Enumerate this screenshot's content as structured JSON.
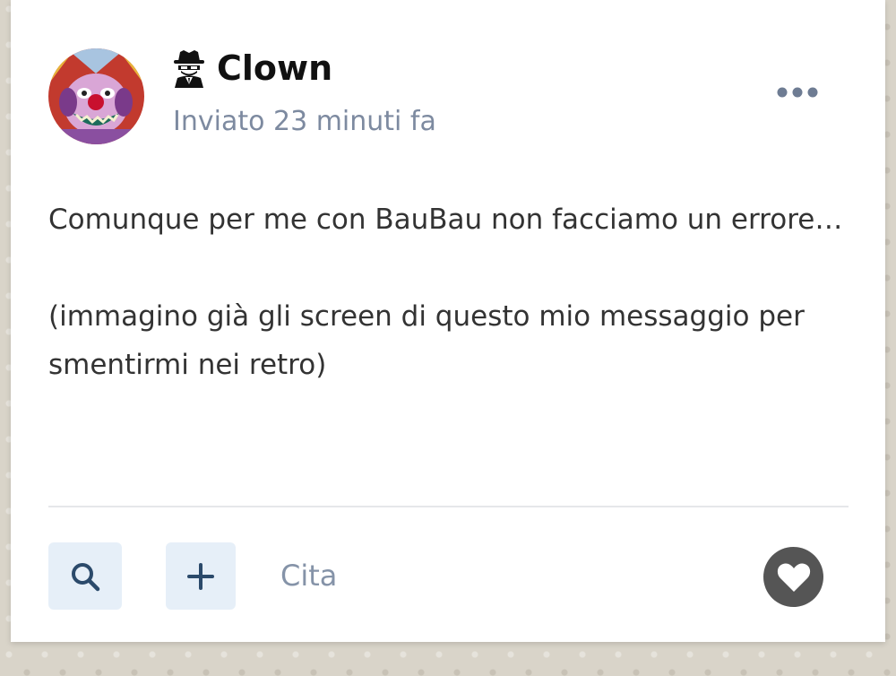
{
  "post": {
    "author": {
      "name": "Clown",
      "badge_icon": "spy-icon",
      "avatar_icon": "clown-avatar"
    },
    "timestamp": "Inviato 23 minuti fa",
    "menu_icon": "more-horizontal-icon",
    "body": [
      "Comunque per me con BauBau non facciamo un errore…",
      "(immagino già gli screen di questo mio messaggio per smentirmi nei retro)"
    ]
  },
  "actions": {
    "search_icon": "search-icon",
    "add_icon": "plus-icon",
    "quote_label": "Cita",
    "like_icon": "heart-icon"
  },
  "colors": {
    "accent_bg": "#e6eff8",
    "icon_blue": "#2b4a6b",
    "muted_text": "#7d8aa0",
    "like_bg": "#555555"
  }
}
